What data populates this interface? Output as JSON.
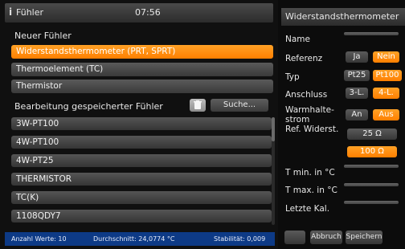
{
  "left_panel": {
    "title": "Fühler",
    "time": "07:56",
    "new_probe_label": "Neuer Fühler",
    "probe_types": [
      "Widerstandsthermometer (PRT, SPRT)",
      "Thermoelement (TC)",
      "Thermistor"
    ],
    "saved_probes_label": "Bearbeitung gespeicherter Fühler",
    "search_label": "Suche...",
    "saved_probes": [
      "3W-PT100",
      "4W-PT100",
      "4W-PT25",
      "THERMISTOR",
      "TC(K)",
      "1108QDY7"
    ],
    "status": {
      "count": "Anzahl Werte: 10",
      "average": "Durchschnitt: 24,0774 °C",
      "stability": "Stabilität: 0,009"
    }
  },
  "right_panel": {
    "title": "Widerstandsthermometer",
    "labels": {
      "name": "Name",
      "reference": "Referenz",
      "type": "Typ",
      "connection": "Anschluss",
      "warmhold": "Warmhalte-strom",
      "ref_resistance": "Ref. Widerst.",
      "tmin": "T min. in °C",
      "tmax": "T max. in °C",
      "last_cal": "Letzte Kal."
    },
    "reference": {
      "yes": "Ja",
      "no": "Nein"
    },
    "type": {
      "pt25": "Pt25",
      "pt100": "Pt100"
    },
    "connection": {
      "three": "3-L.",
      "four": "4-L."
    },
    "warmhold": {
      "on": "An",
      "off": "Aus"
    },
    "ref_resistance": {
      "r25": "25 Ω",
      "r100": "100 Ω"
    },
    "buttons": {
      "cancel": "Abbruch",
      "save": "Speichern"
    },
    "accent_color": "#ff8a10"
  }
}
